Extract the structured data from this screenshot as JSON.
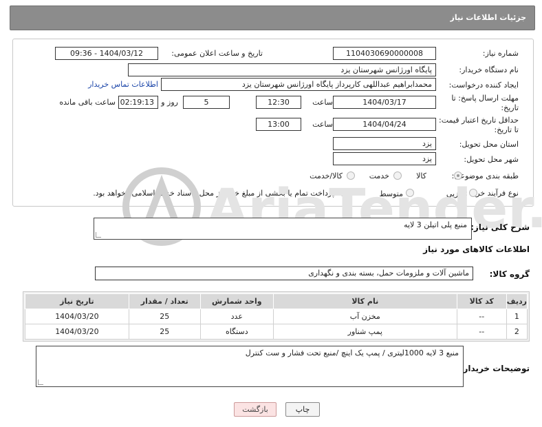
{
  "header": {
    "title": "جزئیات اطلاعات نیاز"
  },
  "form": {
    "need_number_label": "شماره نیاز:",
    "need_number": "1104030690000008",
    "announce_label": "تاریخ و ساعت اعلان عمومی:",
    "announce_value": "1404/03/12 - 09:36",
    "buyer_org_label": "نام دستگاه خریدار:",
    "buyer_org": "پایگاه اورژانس شهرستان یزد",
    "creator_label": "ایجاد کننده درخواست:",
    "creator": "محمدابراهیم عبداللهی کارپرداز پایگاه اورژانس شهرستان یزد",
    "contact_link": "اطلاعات تماس خریدار",
    "deadline_label_1": "مهلت ارسال پاسخ: تا",
    "deadline_label_2": "تاریخ:",
    "deadline_date": "1404/03/17",
    "time_label": "ساعت",
    "deadline_time": "12:30",
    "days_value": "5",
    "days_label": "روز و",
    "remaining_time": "02:19:13",
    "remaining_label": "ساعت باقی مانده",
    "price_validity_label_1": "حداقل تاریخ اعتبار قیمت:",
    "price_validity_label_2": "تا تاریخ:",
    "price_validity_date": "1404/04/24",
    "price_validity_time": "13:00",
    "province_label": "استان محل تحویل:",
    "province": "یزد",
    "city_label": "شهر محل تحویل:",
    "city": "یزد",
    "category_label": "طبقه بندی موضوعی:",
    "category_options": [
      "کالا",
      "خدمت",
      "کالا/خدمت"
    ],
    "process_label": "نوع فرآیند خرید :",
    "process_options": [
      "جزیی",
      "متوسط"
    ],
    "payment_note": "پرداخت تمام یا بخشی از مبلغ خرید،از محل \"اسناد خزانه اسلامی\" خواهد بود."
  },
  "description": {
    "label": "شرح کلی نیاز:",
    "value": "منبع پلی اتیلن 3 لایه"
  },
  "goods": {
    "title": "اطلاعات کالاهای مورد نیاز",
    "group_label": "گروه کالا:",
    "group_value": "ماشین آلات و ملزومات حمل، بسته بندی و نگهداری",
    "columns": [
      "ردیف",
      "کد کالا",
      "نام کالا",
      "واحد شمارش",
      "تعداد / مقدار",
      "تاریخ نیاز"
    ],
    "rows": [
      [
        "1",
        "--",
        "مخزن آب",
        "عدد",
        "25",
        "1404/03/20"
      ],
      [
        "2",
        "--",
        "پمپ شناور",
        "دستگاه",
        "25",
        "1404/03/20"
      ]
    ]
  },
  "buyer_notes": {
    "label": "توضیحات خریدار:",
    "value": "منبع 3 لایه 1000لیتری / پمپ یک اینچ /منبع تحت فشار و ست کنترل"
  },
  "buttons": {
    "print": "چاپ",
    "back": "بازگشت"
  },
  "watermark": {
    "text": "AriaTender.neT"
  },
  "colors": {
    "header_bg": "#8c8c8c",
    "link": "#1a44a8",
    "back_button_bg": "#fbe3e3"
  }
}
